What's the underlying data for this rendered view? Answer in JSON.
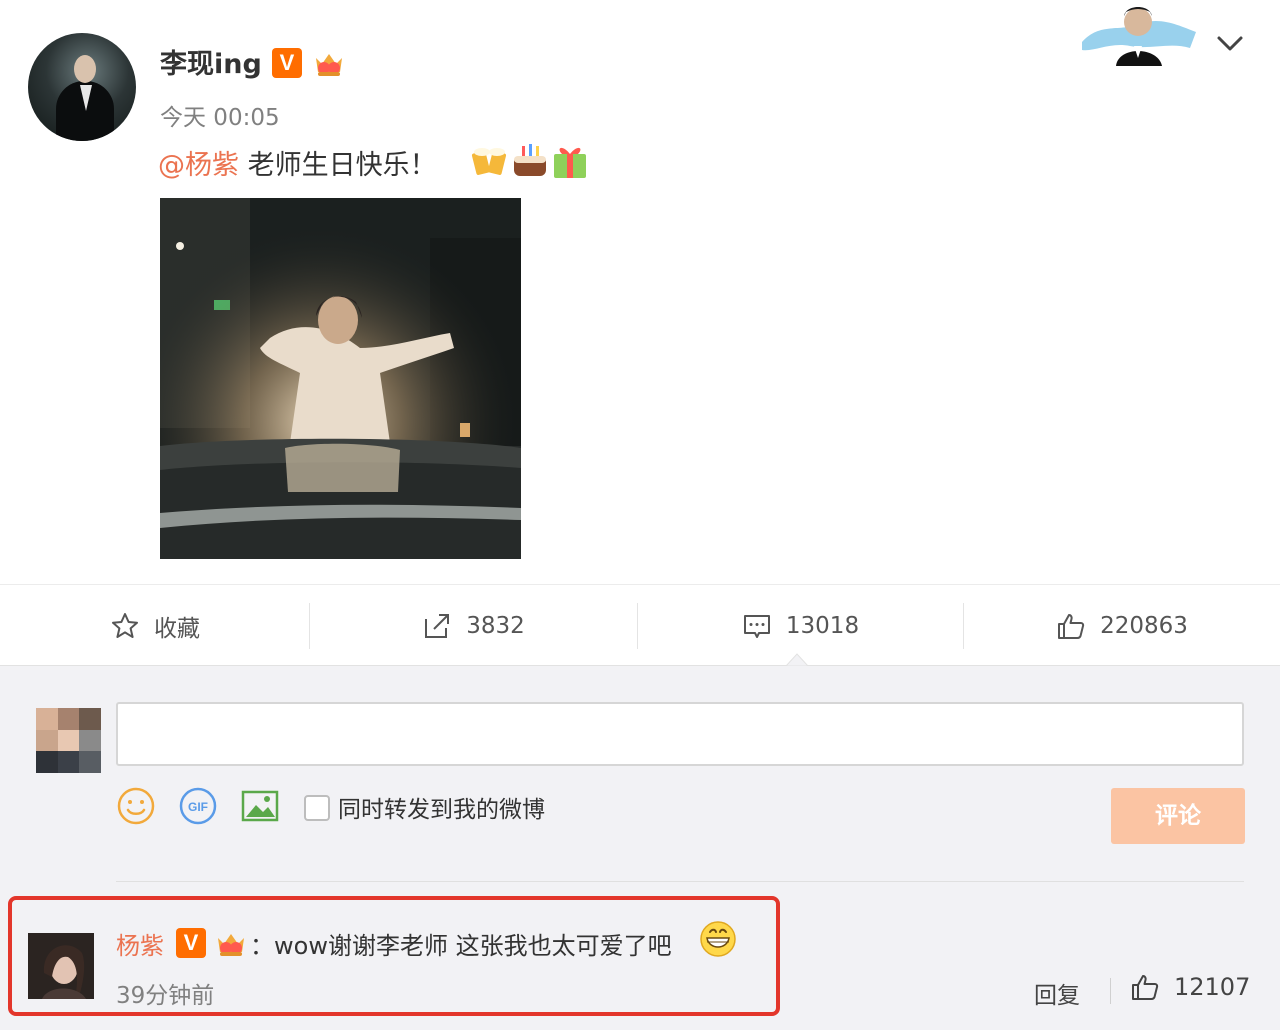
{
  "post": {
    "username": "李现ing",
    "verified_badge": "V",
    "time": "今天 00:05",
    "mention": "@杨紫",
    "text": " 老师生日快乐！",
    "emojis": [
      "cheers-icon",
      "cake-icon",
      "gift-icon"
    ]
  },
  "actions": {
    "favorite_label": "收藏",
    "repost_count": "3832",
    "comment_count": "13018",
    "like_count": "220863"
  },
  "composer": {
    "input_value": "",
    "repost_option_label": "同时转发到我的微博",
    "repost_checked": false,
    "submit_label": "评论",
    "tools": [
      "emoji-icon",
      "gif-icon",
      "image-icon"
    ]
  },
  "reply": {
    "author": "杨紫",
    "verified_badge": "V",
    "separator": "：",
    "text": "wow谢谢李老师 这张我也太可爱了吧",
    "time": "39分钟前",
    "reply_label": "回复",
    "like_count": "12107"
  },
  "colors": {
    "mention": "#eb7350",
    "badge": "#ff6d00",
    "submit_disabled": "#fbc4a3",
    "highlight_box": "#e3362b"
  }
}
